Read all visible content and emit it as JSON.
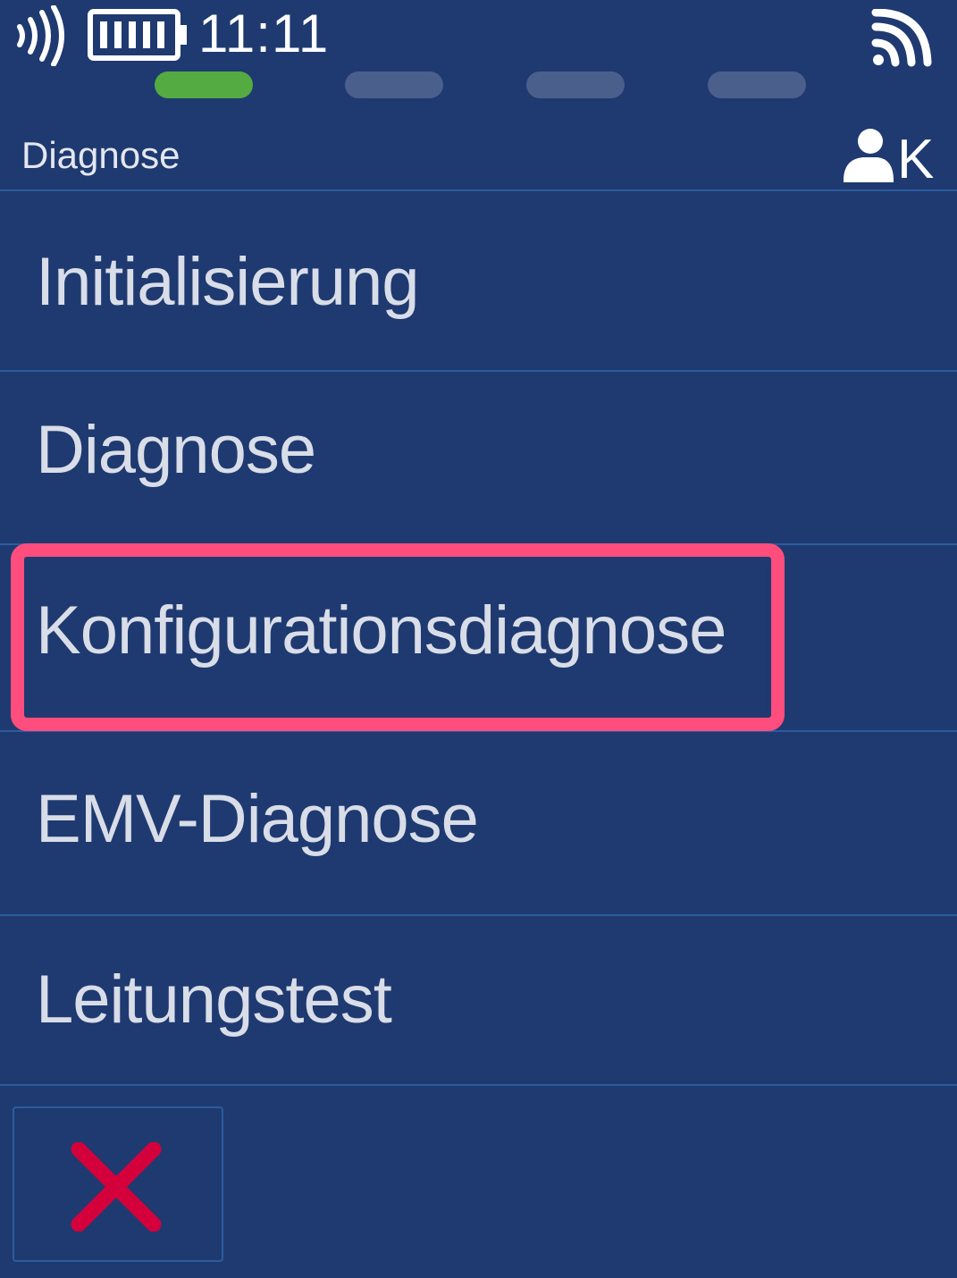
{
  "statusbar": {
    "time": "11:11",
    "icons": [
      "nfc-contactless-icon",
      "battery-icon",
      "wifi-signal-icon"
    ]
  },
  "progress": {
    "total_steps": 4,
    "active_step": 1,
    "colors": {
      "active": "#54ab42",
      "inactive": "#4a5f8c"
    }
  },
  "header": {
    "title": "Diagnose",
    "user_letter": "K",
    "user_icon": "user-icon"
  },
  "menu": {
    "items": [
      {
        "label": "Initialisierung",
        "selected": false
      },
      {
        "label": "Diagnose",
        "selected": false
      },
      {
        "label": "Konfigurationsdiagnose",
        "selected": true
      },
      {
        "label": "EMV-Diagnose",
        "selected": false
      },
      {
        "label": "Leitungstest",
        "selected": false
      }
    ]
  },
  "footer": {
    "cancel_icon": "close-icon"
  },
  "colors": {
    "background": "#1f3a70",
    "divider": "#2a5c9e",
    "highlight": "#ff4d7d",
    "cancel": "#d4003c"
  }
}
